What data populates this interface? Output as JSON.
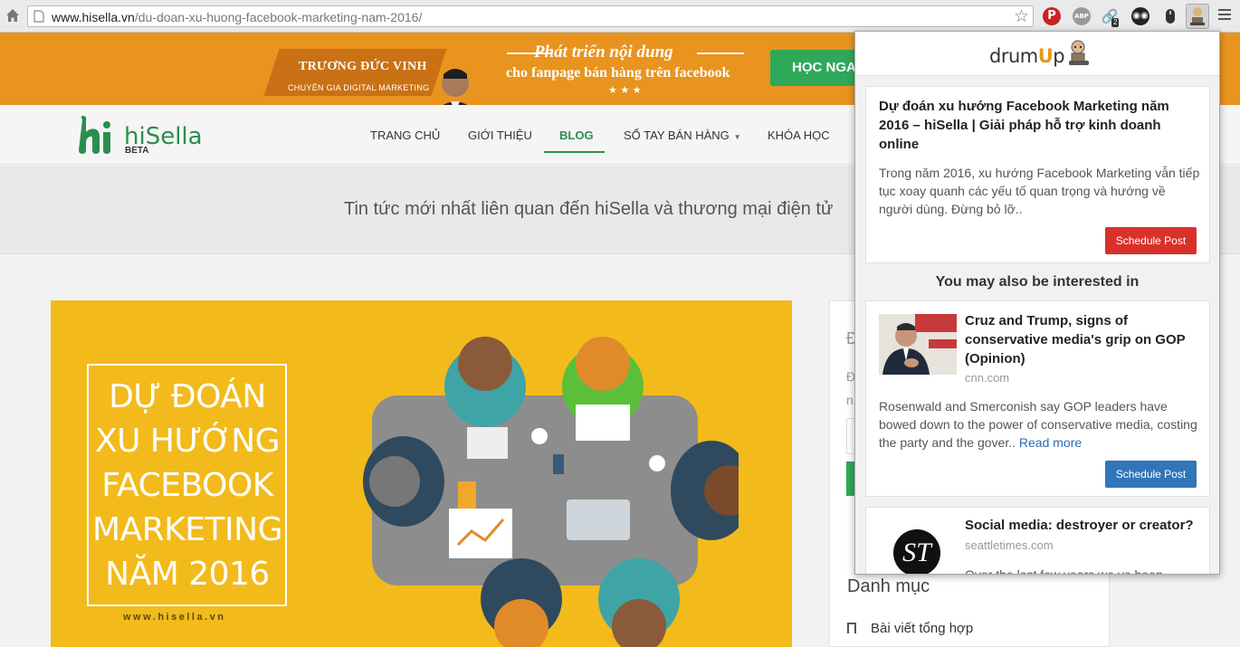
{
  "browser": {
    "url_host": "www.hisella.vn",
    "url_path": "/du-doan-xu-huong-facebook-marketing-nam-2016/",
    "extensions": [
      "pinterest-icon",
      "adblock-plus-icon",
      "link-icon",
      "owl-icon",
      "mouse-icon",
      "drumup-icon"
    ],
    "link_badge": "2",
    "abp_label": "ABP"
  },
  "banner": {
    "name": "TRƯƠNG ĐỨC VINH",
    "role": "CHUYÊN GIA DIGITAL MARKETING",
    "tagline1": "Phát triển nội dung",
    "tagline2": "cho fanpage bán hàng trên facebook",
    "stars": "★ ★ ★",
    "cta": "HỌC NGA",
    "bg_color": "#e8941f"
  },
  "site": {
    "logo": "hiSella",
    "logo_badge": "BETA",
    "brand_color": "#2d8d4e",
    "nav": [
      "TRANG CHỦ",
      "GIỚI THIỆU",
      "BLOG",
      "SỔ TAY BÁN HÀNG",
      "KHÓA HỌC"
    ],
    "nav_active": "BLOG",
    "subtitle": "Tin tức mới nhất liên quan đến hiSella và thương mại điện tử"
  },
  "hero": {
    "lines": [
      "DỰ ĐOÁN",
      "XU HƯỚNG",
      "FACEBOOK",
      "MARKETING",
      "NĂM 2016"
    ],
    "url": "www.hisella.vn"
  },
  "sidebar": {
    "letter1": "Đ",
    "letter2": "Đ",
    "letter3": "n",
    "heading": "Danh mục",
    "item": "Bài viết tổng hợp"
  },
  "popup": {
    "logo_prefix": "drum",
    "logo_u": "U",
    "logo_suffix": "p",
    "main": {
      "title": "Dự đoán xu hướng Facebook Marketing năm 2016 – hiSella | Giải pháp hỗ trợ kinh doanh online",
      "description": "Trong năm 2016, xu hướng Facebook Marketing vẫn tiếp tục xoay quanh các yếu tố quan trọng và hướng về người dùng. Đừng bỏ lỡ..",
      "button": "Schedule Post"
    },
    "related_heading": "You may also be interested in",
    "related": [
      {
        "title": "Cruz and Trump, signs of conservative media's grip on GOP (Opinion)",
        "source": "cnn.com",
        "description": "Rosenwald and Smerconish say GOP leaders have bowed down to the power of conservative media, costing the party and the gover..",
        "read_more": "Read more",
        "button": "Schedule Post"
      },
      {
        "title": "Social media: destroyer or creator?",
        "source": "seattletimes.com",
        "logo": "ST",
        "description": "Over the last few years we ve been"
      }
    ]
  }
}
